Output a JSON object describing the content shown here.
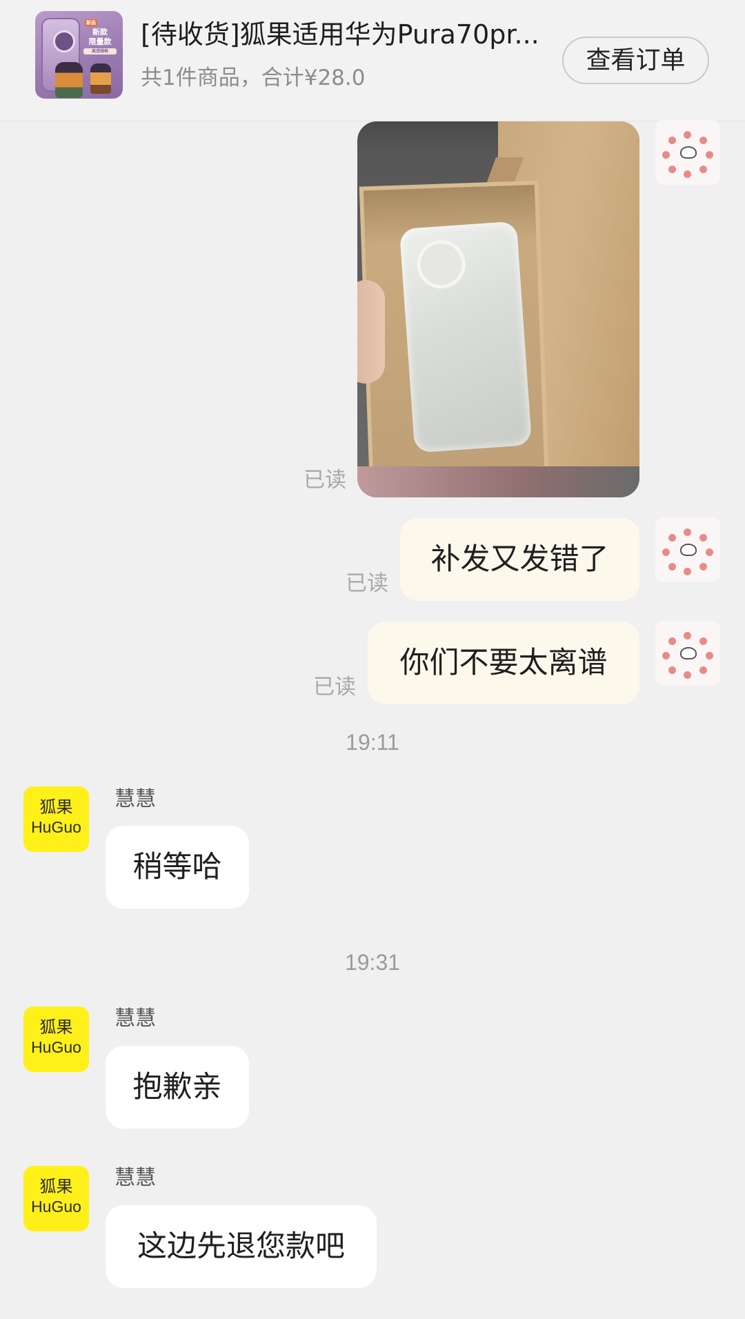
{
  "order": {
    "title": "[待收货]狐果适用华为Pura70pr...",
    "summary": "共1件商品，合计¥28.0",
    "view_order_label": "查看订单",
    "thumbnail": {
      "badge_tag": "新品",
      "badge_line1": "新款",
      "badge_line2": "限量款",
      "badge_sub": "高透镜框"
    }
  },
  "messages": {
    "photo": {
      "read_label": "已读"
    },
    "me_1": {
      "text": "补发又发错了",
      "read_label": "已读"
    },
    "me_2": {
      "text": "你们不要太离谱",
      "read_label": "已读"
    },
    "time_1": "19:11",
    "them_1": {
      "sender": "慧慧",
      "text": "稍等哈"
    },
    "time_2": "19:31",
    "them_2": {
      "sender": "慧慧",
      "text": "抱歉亲"
    },
    "them_3": {
      "sender": "慧慧",
      "text": "这边先退您款吧"
    }
  },
  "shop_avatar": {
    "cn": "狐果",
    "en": "HuGuo"
  },
  "colors": {
    "background": "#f0f0f0",
    "my_bubble": "#fdf8ec",
    "their_bubble": "#ffffff",
    "shop_avatar": "#fff01a",
    "read_label": "#a9a9a9"
  }
}
